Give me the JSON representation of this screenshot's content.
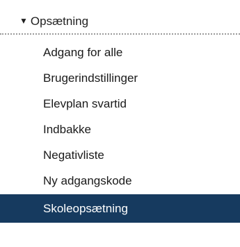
{
  "section": {
    "caret": "▼",
    "title": "Opsætning"
  },
  "items": [
    {
      "label": "Adgang for alle"
    },
    {
      "label": "Brugerindstillinger"
    },
    {
      "label": "Elevplan svartid"
    },
    {
      "label": "Indbakke"
    },
    {
      "label": "Negativliste"
    },
    {
      "label": "Ny adgangskode"
    },
    {
      "label": "Skoleopsætning",
      "active": true
    }
  ],
  "colors": {
    "active_background": "#163a5f",
    "active_text": "#ffffff",
    "text": "#1a1a1a"
  }
}
